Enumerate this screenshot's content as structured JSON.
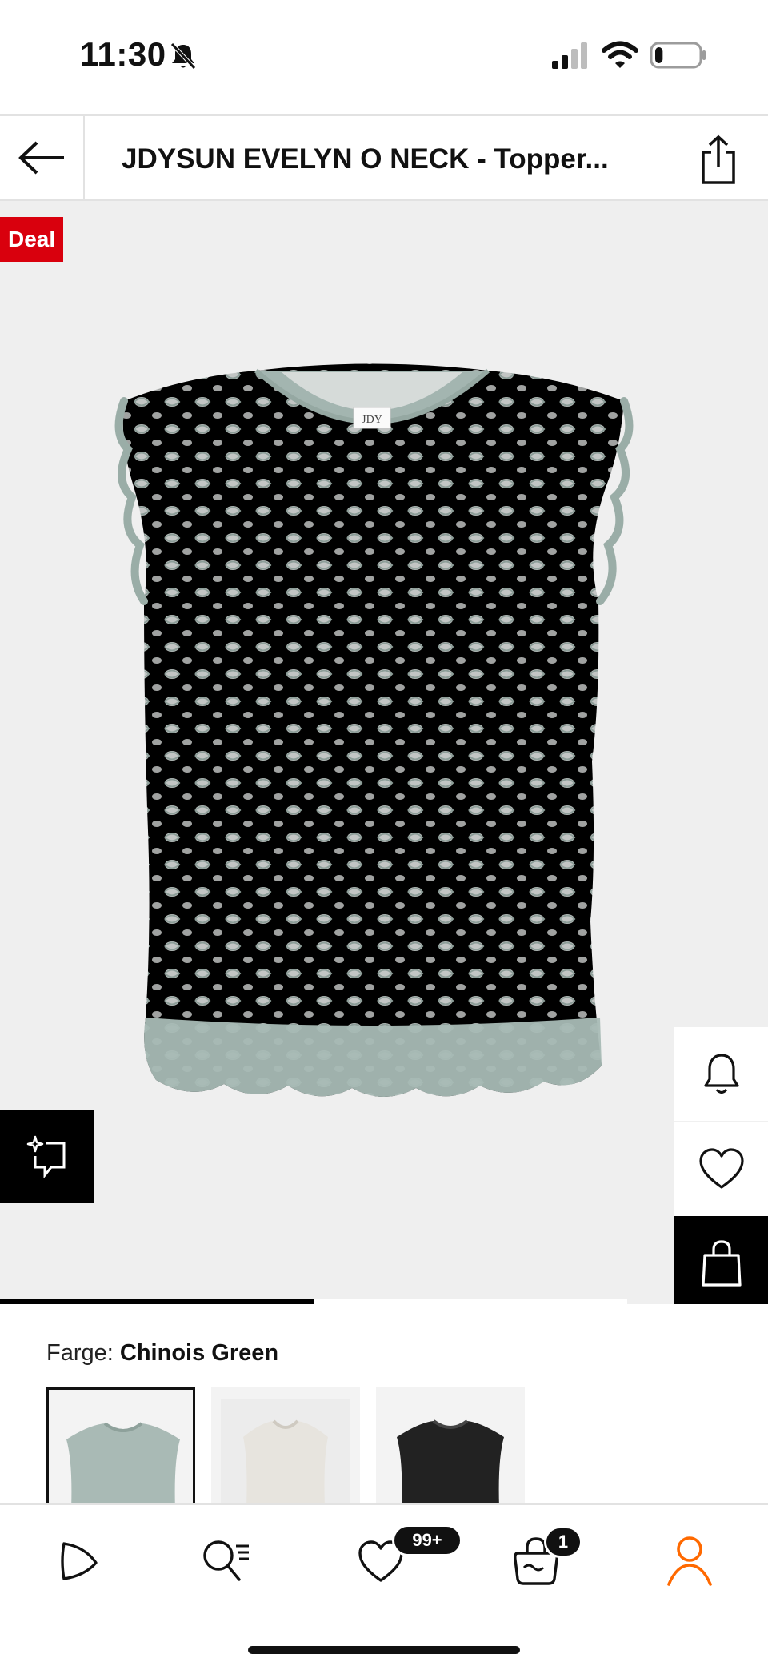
{
  "status_bar": {
    "time": "11:30",
    "battery_level": 0.18
  },
  "header": {
    "title": "JDYSUN EVELYN O NECK - Topper..."
  },
  "hero": {
    "deal_label": "Deal",
    "gallery_progress": 0.5,
    "product_colour": "#aebfba"
  },
  "color_picker": {
    "label": "Farge:",
    "selected_value": "Chinois Green",
    "swatches": [
      {
        "name": "Chinois Green",
        "hex": "#a9bab5",
        "selected": true
      },
      {
        "name": "white",
        "hex": "#e7e4de",
        "selected": false
      },
      {
        "name": "black",
        "hex": "#222222",
        "selected": false
      }
    ]
  },
  "bottom_nav": {
    "wishlist_badge": "99+",
    "cart_badge": "1",
    "active_color": "#ff6900"
  }
}
